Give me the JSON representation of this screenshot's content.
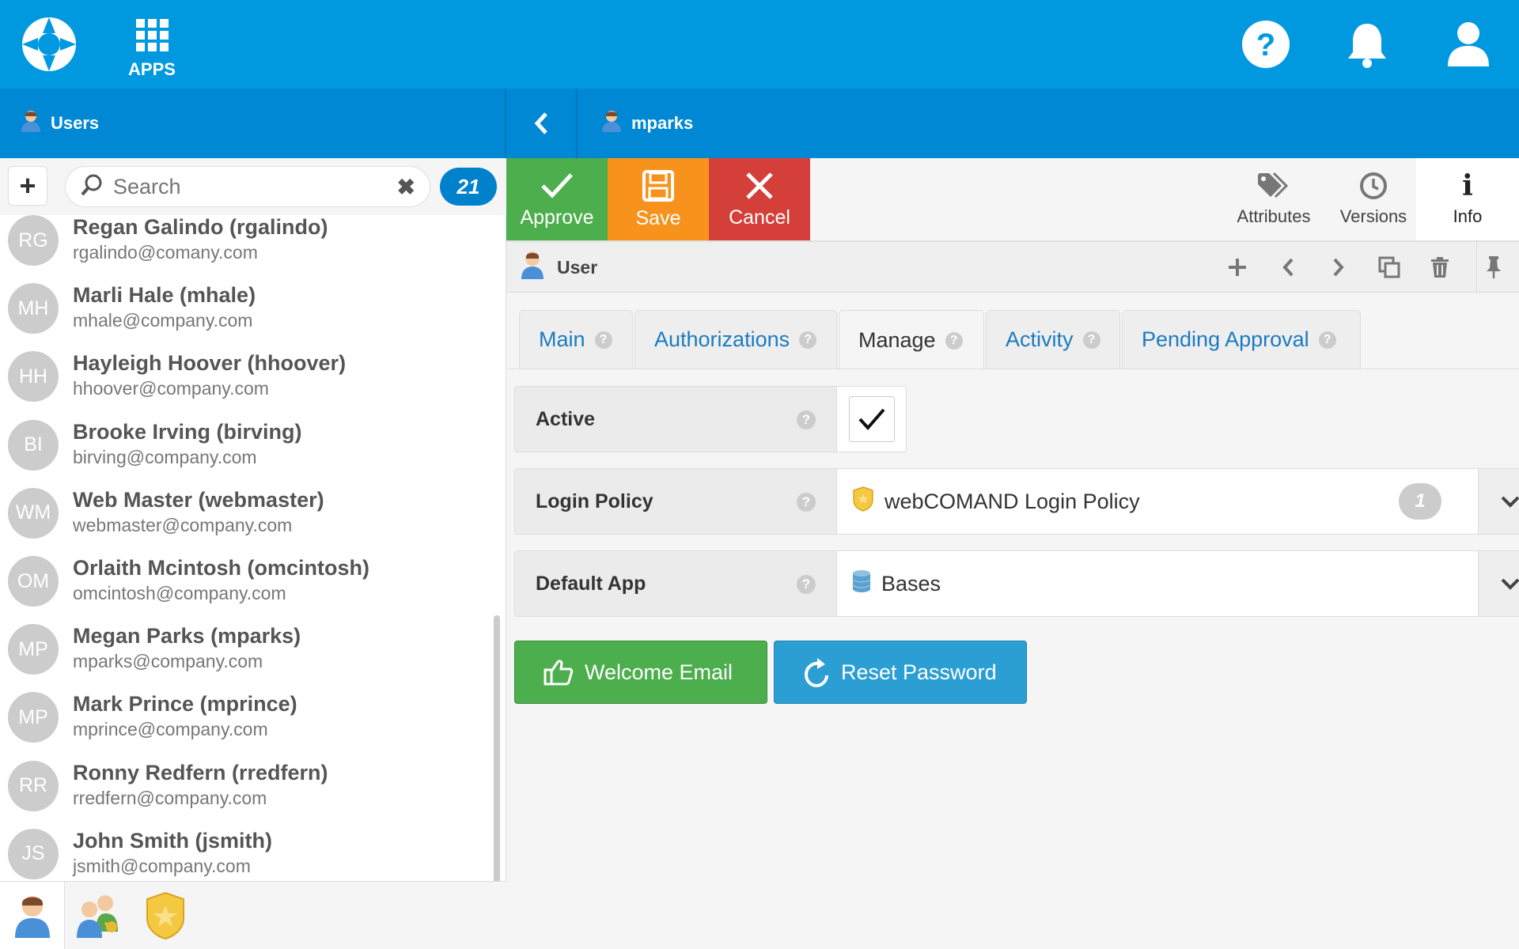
{
  "header": {
    "apps_label": "APPS",
    "brand_color": "#0099e0"
  },
  "subbar": {
    "list_title": "Users",
    "record_title": "mparks"
  },
  "left": {
    "search_placeholder": "Search",
    "count": "21",
    "users": [
      {
        "initials": "RG",
        "name": "Regan Galindo (rgalindo)",
        "email": "rgalindo@comany.com"
      },
      {
        "initials": "MH",
        "name": "Marli Hale (mhale)",
        "email": "mhale@company.com"
      },
      {
        "initials": "HH",
        "name": "Hayleigh Hoover (hhoover)",
        "email": "hhoover@company.com"
      },
      {
        "initials": "BI",
        "name": "Brooke Irving (birving)",
        "email": "birving@company.com"
      },
      {
        "initials": "WM",
        "name": "Web Master (webmaster)",
        "email": "webmaster@company.com"
      },
      {
        "initials": "OM",
        "name": "Orlaith Mcintosh (omcintosh)",
        "email": "omcintosh@company.com"
      },
      {
        "initials": "MP",
        "name": "Megan Parks (mparks)",
        "email": "mparks@company.com"
      },
      {
        "initials": "MP",
        "name": "Mark Prince (mprince)",
        "email": "mprince@company.com"
      },
      {
        "initials": "RR",
        "name": "Ronny Redfern (rredfern)",
        "email": "rredfern@company.com"
      },
      {
        "initials": "JS",
        "name": "John Smith (jsmith)",
        "email": "jsmith@company.com"
      }
    ]
  },
  "actions": {
    "approve": "Approve",
    "save": "Save",
    "cancel": "Cancel",
    "attributes": "Attributes",
    "versions": "Versions",
    "info": "Info"
  },
  "record": {
    "type_label": "User"
  },
  "tabs": [
    "Main",
    "Authorizations",
    "Manage",
    "Activity",
    "Pending Approval"
  ],
  "active_tab": "Manage",
  "fields": {
    "active_label": "Active",
    "active_checked": true,
    "login_policy_label": "Login Policy",
    "login_policy_value": "webCOMAND Login Policy",
    "login_policy_count": "1",
    "default_app_label": "Default App",
    "default_app_value": "Bases"
  },
  "buttons": {
    "welcome_email": "Welcome Email",
    "reset_password": "Reset Password"
  }
}
